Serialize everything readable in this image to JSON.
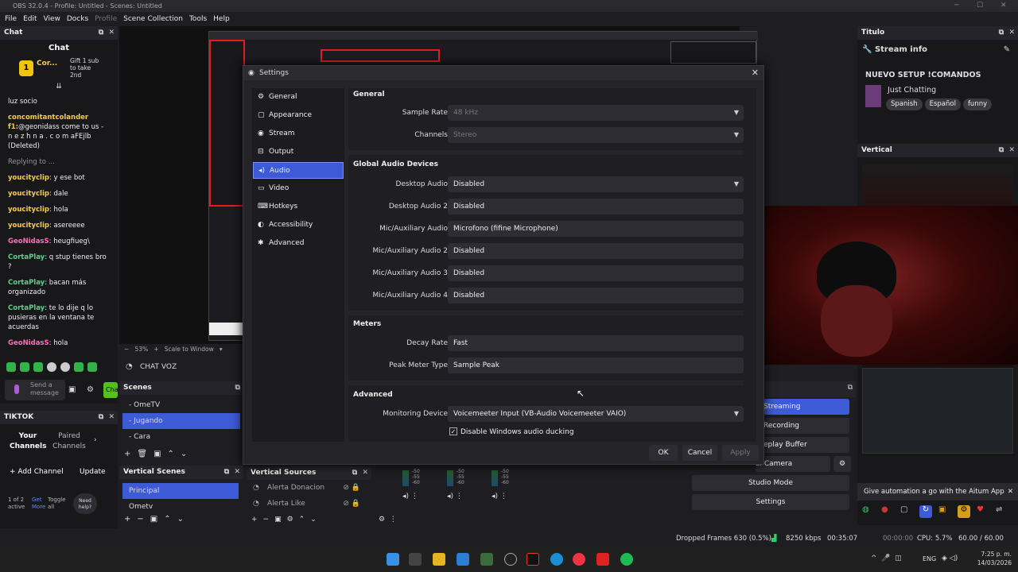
{
  "window": {
    "title": "OBS 32.0.4 - Profile: Untitled - Scenes: Untitled"
  },
  "menu": [
    "File",
    "Edit",
    "View",
    "Docks",
    "Profile",
    "Scene Collection",
    "Tools",
    "Help"
  ],
  "chat": {
    "dock_title": "Chat",
    "header": "Chat",
    "gift_user": "Cor...",
    "gift_text": "Gift 1 sub to take 2nd",
    "messages": [
      {
        "user": "",
        "text": "luz socio",
        "color": ""
      },
      {
        "user": "concomitantcolander f1:",
        "text": "@geonidass come to us - n e z h n a . c o m aFEjlb (Deleted)",
        "color": "y"
      },
      {
        "user": "",
        "text": "Replying to ...",
        "color": ""
      },
      {
        "user": "youcityclip",
        "text": ": y ese bot",
        "color": "y"
      },
      {
        "user": "youcityclip",
        "text": ": dale",
        "color": "y"
      },
      {
        "user": "youcityclip",
        "text": ": hola",
        "color": "y"
      },
      {
        "user": "youcityclip",
        "text": ": asereeee",
        "color": "y"
      },
      {
        "user": "GeoNidasS",
        "text": ": heugfiueg\\",
        "color": "p"
      },
      {
        "user": "CortaPlay",
        "text": ": q stup tienes bro ?",
        "color": "g"
      },
      {
        "user": "CortaPlay",
        "text": ": bacan más organizado",
        "color": "g"
      },
      {
        "user": "CortaPlay",
        "text": ": te lo dije q lo pusieras en la ventana te acuerdas",
        "color": "g"
      },
      {
        "user": "GeoNidasS",
        "text": ": hola",
        "color": "p"
      }
    ],
    "send_placeholder": "Send a message",
    "chat_button": "Chat"
  },
  "tiktok": {
    "dock_title": "TIKTOK",
    "tab_your": "Your Channels",
    "tab_paired": "Paired Channels",
    "add": "Add Channel",
    "update": "Update",
    "page": "1 of 2 active",
    "get_more": "Get More",
    "toggle_all": "Toggle all",
    "help": "Need help?"
  },
  "preview": {
    "zoom": "53%",
    "zoom_mode": "Scale to Window"
  },
  "chatvoz": {
    "label": "CHAT VOZ"
  },
  "scenes": {
    "title": "Scenes",
    "items": [
      "- OmeTV",
      "- Jugando",
      "- Cara"
    ],
    "active": 1
  },
  "vscenes": {
    "title": "Vertical Scenes",
    "items": [
      "Principal",
      "Ometv"
    ],
    "active": 0
  },
  "vsources": {
    "title": "Vertical Sources",
    "items": [
      "Alerta Donacion",
      "Alerta Like"
    ]
  },
  "mixer": {
    "ticks": [
      "-50",
      "-55",
      "-60"
    ]
  },
  "controls": {
    "streaming": "Streaming",
    "recording": "Recording",
    "replay": "eplay Buffer",
    "vcam": "al Camera",
    "studio": "Studio Mode",
    "settings": "Settings"
  },
  "titulo": {
    "dock_title": "Titulo",
    "stream_info": "Stream info",
    "setup": "NUEVO SETUP !COMANDOS",
    "category": "Just Chatting",
    "tags": [
      "Spanish",
      "Español",
      "funny"
    ]
  },
  "vertical": {
    "dock_title": "Vertical",
    "aitum": "Give automation a go with the Aitum App"
  },
  "settings": {
    "title": "Settings",
    "nav": [
      "General",
      "Appearance",
      "Stream",
      "Output",
      "Audio",
      "Video",
      "Hotkeys",
      "Accessibility",
      "Advanced"
    ],
    "nav_icons": [
      "⚙",
      "▢",
      "◉",
      "⊟",
      "◂)",
      "▭",
      "⌨",
      "◐",
      "✱"
    ],
    "active": 4,
    "general": {
      "title": "General",
      "sample_rate_label": "Sample Rate",
      "sample_rate": "48 kHz",
      "channels_label": "Channels",
      "channels": "Stereo"
    },
    "global": {
      "title": "Global Audio Devices",
      "rows": [
        {
          "label": "Desktop Audio",
          "value": "Disabled"
        },
        {
          "label": "Desktop Audio 2",
          "value": "Disabled"
        },
        {
          "label": "Mic/Auxiliary Audio",
          "value": "Microfono (fifine Microphone)"
        },
        {
          "label": "Mic/Auxiliary Audio 2",
          "value": "Disabled"
        },
        {
          "label": "Mic/Auxiliary Audio 3",
          "value": "Disabled"
        },
        {
          "label": "Mic/Auxiliary Audio 4",
          "value": "Disabled"
        }
      ]
    },
    "meters": {
      "title": "Meters",
      "decay_label": "Decay Rate",
      "decay": "Fast",
      "peak_label": "Peak Meter Type",
      "peak": "Sample Peak"
    },
    "advanced": {
      "title": "Advanced",
      "monitor_label": "Monitoring Device",
      "monitor": "Voicemeeter Input (VB-Audio Voicemeeter VAIO)",
      "ducking": "Disable Windows audio ducking"
    },
    "ok": "OK",
    "cancel": "Cancel",
    "apply": "Apply"
  },
  "status": {
    "dropped": "Dropped Frames 630 (0.5%)",
    "kbps": "8250 kbps",
    "live": "00:35:07",
    "rec": "00:00:00",
    "cpu": "CPU: 5.7%",
    "fps": "60.00 / 60.00 FPS"
  },
  "taskbar": {
    "lang": "ENG",
    "time": "7:25 p. m.",
    "date": "14/03/2026"
  },
  "colors": {
    "accent": "#3d5bd6",
    "bg": "#1e1e22"
  }
}
